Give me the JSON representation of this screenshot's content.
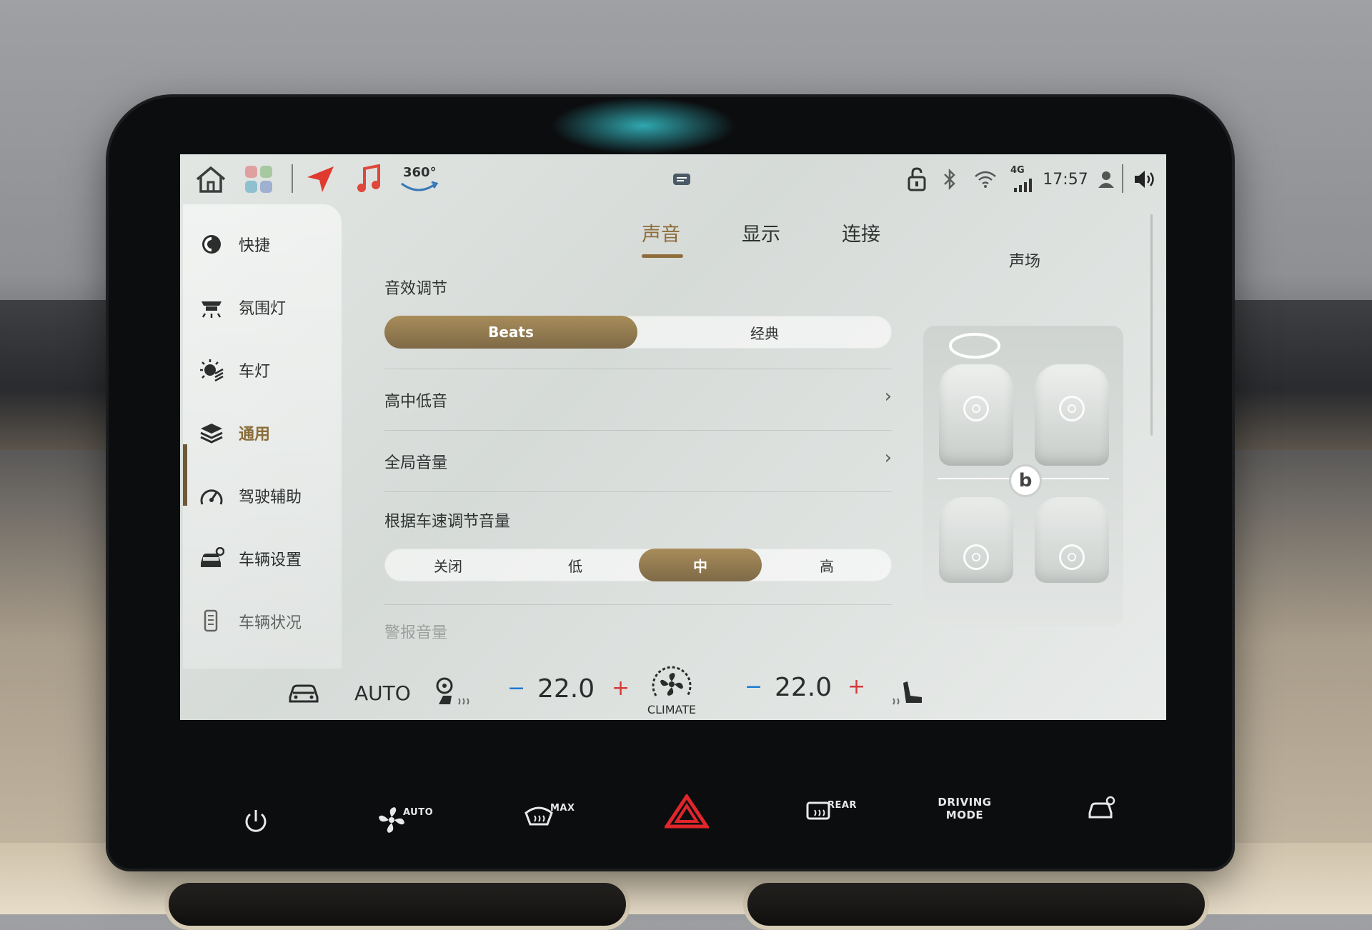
{
  "statusbar": {
    "panorama_label": "360°",
    "network_label": "4G",
    "time": "17:57"
  },
  "sidebar": {
    "items": [
      {
        "label": "快捷",
        "icon": "quick-icon"
      },
      {
        "label": "氛围灯",
        "icon": "ambient-light-icon"
      },
      {
        "label": "车灯",
        "icon": "car-light-icon"
      },
      {
        "label": "通用",
        "icon": "general-layers-icon",
        "active": true
      },
      {
        "label": "驾驶辅助",
        "icon": "driving-assist-icon"
      },
      {
        "label": "车辆设置",
        "icon": "vehicle-settings-icon"
      },
      {
        "label": "车辆状况",
        "icon": "vehicle-status-icon"
      }
    ]
  },
  "tabs": [
    {
      "label": "声音",
      "active": true
    },
    {
      "label": "显示",
      "active": false
    },
    {
      "label": "连接",
      "active": false
    }
  ],
  "sound": {
    "effect_label": "音效调节",
    "effect_options": [
      "Beats",
      "经典"
    ],
    "effect_selected": "Beats",
    "eq_label": "高中低音",
    "global_volume_label": "全局音量",
    "speed_volume_label": "根据车速调节音量",
    "speed_volume_options": [
      "关闭",
      "低",
      "中",
      "高"
    ],
    "speed_volume_selected": "中",
    "alarm_volume_label": "警报音量",
    "soundfield_label": "声场"
  },
  "climate": {
    "mode": "AUTO",
    "left_temp": "22.0",
    "right_temp": "22.0",
    "minus": "−",
    "plus": "+",
    "center_label": "CLIMATE"
  },
  "hardware_buttons": {
    "fan_auto": "AUTO",
    "defrost_max": "MAX",
    "rear_defrost": "REAR",
    "driving_mode_line1": "DRIVING",
    "driving_mode_line2": "MODE"
  },
  "colors": {
    "accent": "#8e6d3b",
    "selected_segment": "#8f7a52",
    "minus": "#1a7bd0",
    "plus": "#d53a3a",
    "hazard": "#e0262b"
  }
}
